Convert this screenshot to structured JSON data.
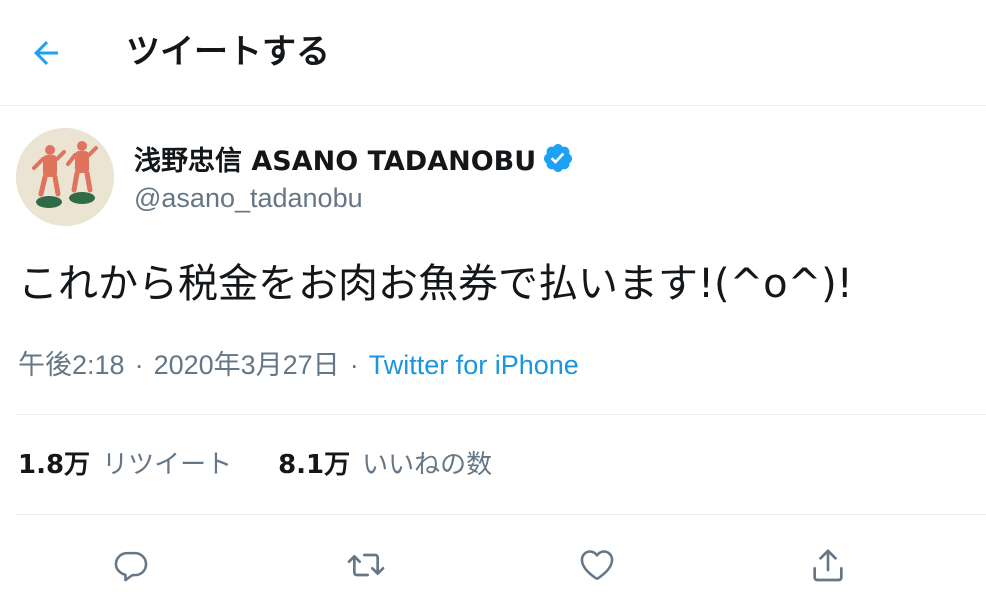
{
  "header": {
    "title": "ツイートする",
    "back_icon": "arrow-left-icon",
    "accent_color": "#1da1f2"
  },
  "tweet": {
    "author": {
      "display_name": "浅野忠信 ASANO TADANOBU",
      "handle": "@asano_tadanobu",
      "verified": true,
      "verified_icon": "verified-badge-icon"
    },
    "text": "これから税金をお肉お魚券で払います!(^o^)!",
    "time": "午後2:18",
    "date": "2020年3月27日",
    "separator": "·",
    "source": "Twitter for iPhone",
    "source_color": "#1b95e0"
  },
  "stats": {
    "retweets": {
      "count": "1.8万",
      "label": "リツイート"
    },
    "likes": {
      "count": "8.1万",
      "label": "いいねの数"
    }
  },
  "actions": [
    {
      "name": "reply",
      "icon": "reply-icon"
    },
    {
      "name": "retweet",
      "icon": "retweet-icon"
    },
    {
      "name": "like",
      "icon": "heart-icon"
    },
    {
      "name": "share",
      "icon": "share-icon"
    }
  ]
}
